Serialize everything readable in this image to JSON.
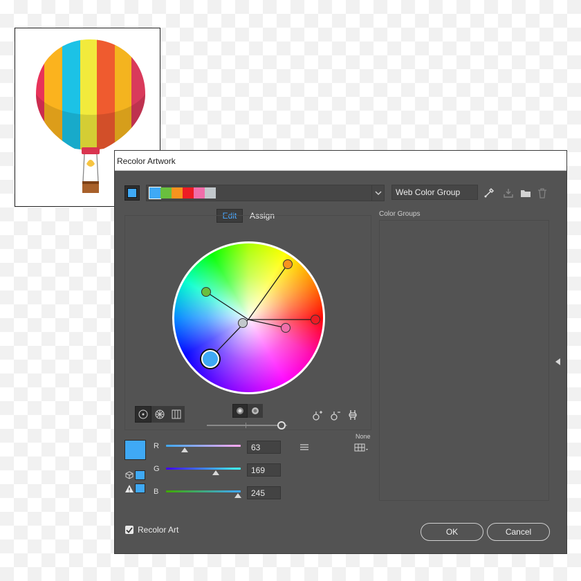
{
  "artwork": {
    "balloon_colors": [
      "#e8335a",
      "#fbb31e",
      "#1cc2e6",
      "#f2ea3c",
      "#ef5b2f",
      "#f4b41f",
      "#d93a5b"
    ]
  },
  "dialog": {
    "title": "Recolor Artwork",
    "active_swatch": "#3fa9f5",
    "color_group_swatches": [
      "#3fa9f5",
      "#69bf3e",
      "#f7931e",
      "#ed1c24",
      "#f06eaa",
      "#c2c8cc"
    ],
    "color_group_name": "Web Color Group",
    "tabs": {
      "edit": "Edit",
      "assign": "Assign"
    },
    "active_tab": "edit",
    "color_groups_label": "Color Groups",
    "wheel_markers": [
      {
        "color": "#3fa9f5",
        "role": "base"
      },
      {
        "color": "#69bf3e"
      },
      {
        "color": "#f7931e"
      },
      {
        "color": "#ed1c24"
      },
      {
        "color": "#f06eaa"
      },
      {
        "color": "#c2c8cc"
      }
    ],
    "brightness_level": 0.93,
    "none_label": "None",
    "rgb": [
      {
        "label": "R",
        "value": "63",
        "fraction": 0.247,
        "gradient": "linear-gradient(to right,#3fa9f5,#ffa9f5)"
      },
      {
        "label": "G",
        "value": "169",
        "fraction": 0.663,
        "gradient": "linear-gradient(to right,#3f00f5,#3fffff)"
      },
      {
        "label": "B",
        "value": "245",
        "fraction": 0.961,
        "gradient": "linear-gradient(to right,#3fa900,#3fa9ff)"
      }
    ],
    "recolor_art_label": "Recolor Art",
    "recolor_art_checked": true,
    "ok_label": "OK",
    "cancel_label": "Cancel"
  }
}
